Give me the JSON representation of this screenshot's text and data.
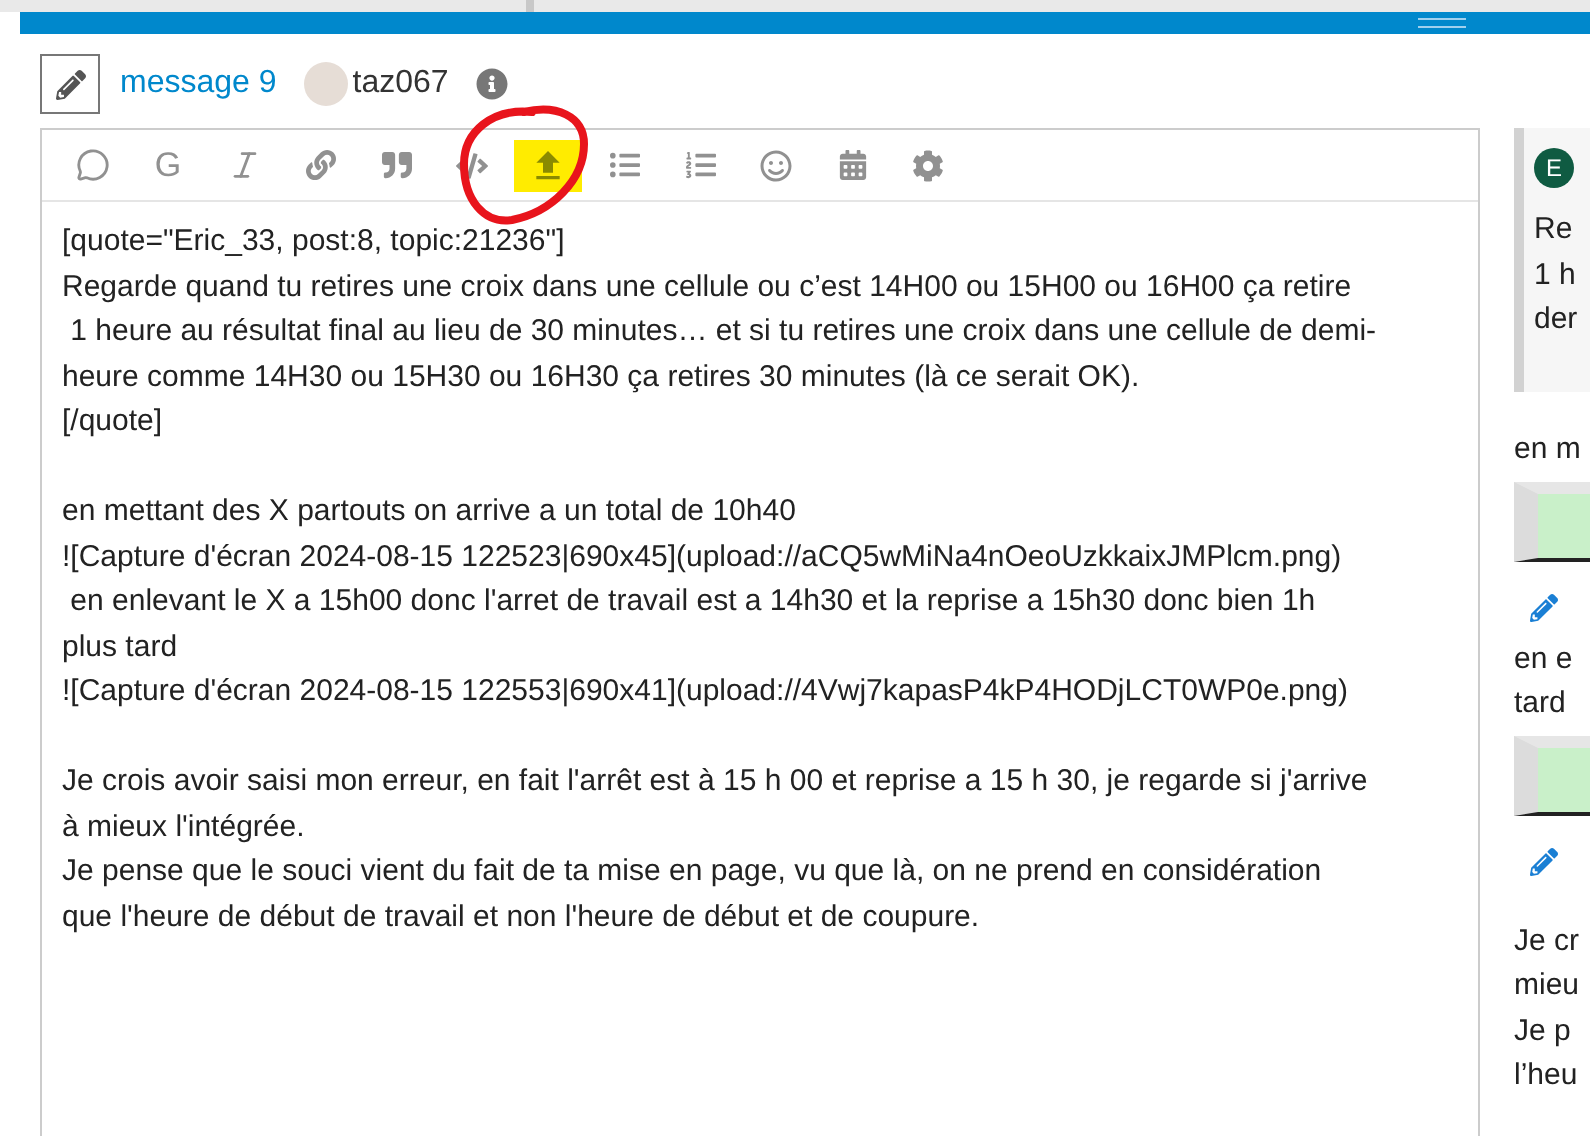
{
  "header": {
    "title": "message 9",
    "username": "taz067"
  },
  "toolbar": [
    {
      "kind": "bubble",
      "highlighted": false
    },
    {
      "kind": "letter",
      "label": "G",
      "highlighted": false
    },
    {
      "kind": "italic",
      "highlighted": false
    },
    {
      "kind": "link",
      "highlighted": false
    },
    {
      "kind": "quote",
      "highlighted": false
    },
    {
      "kind": "code",
      "highlighted": false
    },
    {
      "kind": "upload",
      "highlighted": true
    },
    {
      "kind": "bullets",
      "highlighted": false
    },
    {
      "kind": "numbers",
      "highlighted": false
    },
    {
      "kind": "smiley",
      "highlighted": false
    },
    {
      "kind": "calendar",
      "highlighted": false
    },
    {
      "kind": "gear",
      "highlighted": false
    }
  ],
  "editor": {
    "paragraphs": [
      [
        "[quote=\"Eric_33, post:8, topic:21236\"]",
        "Regarde quand tu retires une croix dans une cellule ou c’est 14H00 ou 15H00 ou 16H00 ça retire",
        " 1 heure au résultat final au lieu de 30 minutes… et si tu retires une croix dans une cellule de demi-",
        "heure comme 14H30 ou 15H30 ou 16H30 ça retires 30 minutes (là ce serait OK).",
        "[/quote]"
      ],
      [
        "en mettant des X partouts on arrive a un total de 10h40",
        "![Capture d'écran 2024-08-15 122523|690x45](upload://aCQ5wMiNa4nOeoUzkkaixJMPlcm.png)",
        " en enlevant le X a 15h00 donc l'arret de travail est a 14h30 et la reprise a 15h30 donc bien 1h",
        "plus tard",
        "![Capture d'écran 2024-08-15 122553|690x41](upload://4Vwj7kapasP4kP4HODjLCT0WP0e.png)"
      ],
      [
        "Je crois avoir saisi mon erreur, en fait l'arrêt est à 15 h 00 et reprise a 15 h 30, je regarde si j'arrive",
        "à mieux l'intégrée.",
        "Je pense que le souci vient du fait de ta mise en page, vu que là, on ne prend en considération",
        "que l'heure de début de travail et non l'heure de début et de coupure."
      ]
    ]
  },
  "preview": {
    "quote": {
      "avatar": "E",
      "lines": [
        "Re",
        "1 h",
        "der"
      ]
    },
    "blocks": [
      {
        "kind": "text",
        "text": "en m"
      },
      {
        "kind": "image"
      },
      {
        "kind": "edit"
      },
      {
        "kind": "text",
        "text": "en e"
      },
      {
        "kind": "text",
        "text": "tard"
      },
      {
        "kind": "image"
      },
      {
        "kind": "edit"
      },
      {
        "kind": "spacer"
      },
      {
        "kind": "text",
        "text": "Je cr"
      },
      {
        "kind": "text",
        "text": "mieu"
      },
      {
        "kind": "text",
        "text": "Je p"
      },
      {
        "kind": "text",
        "text": "l’heu"
      }
    ]
  }
}
